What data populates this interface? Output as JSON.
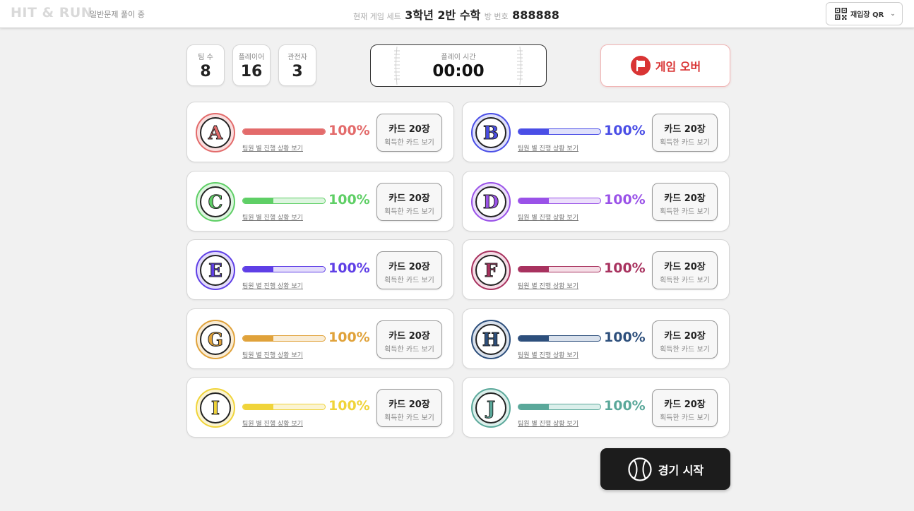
{
  "header": {
    "brand": "HIT & RUN",
    "mode": "일반문제 풀이 중",
    "set_label": "현재 게임 세트",
    "set_value": "3학년 2반 수학",
    "room_label": "방 번호",
    "room_value": "888888",
    "qr_label": "재입장 QR"
  },
  "stats": {
    "teams": {
      "label": "팀 수",
      "value": "8"
    },
    "players": {
      "label": "플레이어",
      "value": "16"
    },
    "spectators": {
      "label": "관전자",
      "value": "3"
    }
  },
  "timer": {
    "label": "플레이 시간",
    "value": "00:00"
  },
  "game_over_label": "게임 오버",
  "start_label": "경기 시작",
  "teams": [
    {
      "letter": "A",
      "color": "#e36b6b",
      "light": "#f9dede",
      "progress": 1.0,
      "fill": 1.0,
      "percent": "100%",
      "link": "팀원 별 진행 상황 보기",
      "card_title": "카드 20장",
      "card_sub": "획득한 카드 보기"
    },
    {
      "letter": "B",
      "color": "#4a4ee6",
      "light": "#dfe0fb",
      "progress": 1.0,
      "fill": 0.37,
      "percent": "100%",
      "link": "팀원 별 진행 상황 보기",
      "card_title": "카드 20장",
      "card_sub": "획득한 카드 보기"
    },
    {
      "letter": "C",
      "color": "#5fcf66",
      "light": "#ddf5df",
      "progress": 1.0,
      "fill": 0.37,
      "percent": "100%",
      "link": "팀원 별 진행 상황 보기",
      "card_title": "카드 20장",
      "card_sub": "획득한 카드 보기"
    },
    {
      "letter": "D",
      "color": "#9a52e8",
      "light": "#ecdffb",
      "progress": 1.0,
      "fill": 0.37,
      "percent": "100%",
      "link": "팀원 별 진행 상황 보기",
      "card_title": "카드 20장",
      "card_sub": "획득한 카드 보기"
    },
    {
      "letter": "E",
      "color": "#5f3fe6",
      "light": "#e3dcfb",
      "progress": 1.0,
      "fill": 0.37,
      "percent": "100%",
      "link": "팀원 별 진행 상황 보기",
      "card_title": "카드 20장",
      "card_sub": "획득한 카드 보기"
    },
    {
      "letter": "F",
      "color": "#a8325f",
      "light": "#f5dde6",
      "progress": 1.0,
      "fill": 0.37,
      "percent": "100%",
      "link": "팀원 별 진행 상황 보기",
      "card_title": "카드 20장",
      "card_sub": "획득한 카드 보기"
    },
    {
      "letter": "G",
      "color": "#e0a23a",
      "light": "#f9ecd5",
      "progress": 1.0,
      "fill": 0.37,
      "percent": "100%",
      "link": "팀원 별 진행 상황 보기",
      "card_title": "카드 20장",
      "card_sub": "획득한 카드 보기"
    },
    {
      "letter": "H",
      "color": "#2d4f7c",
      "light": "#d9e1ec",
      "progress": 1.0,
      "fill": 0.37,
      "percent": "100%",
      "link": "팀원 별 진행 상황 보기",
      "card_title": "카드 20장",
      "card_sub": "획득한 카드 보기"
    },
    {
      "letter": "I",
      "color": "#f0d43a",
      "light": "#fbf4d2",
      "progress": 1.0,
      "fill": 0.37,
      "percent": "100%",
      "link": "팀원 별 진행 상황 보기",
      "card_title": "카드 20장",
      "card_sub": "획득한 카드 보기"
    },
    {
      "letter": "J",
      "color": "#5aa89a",
      "light": "#dbefeb",
      "progress": 1.0,
      "fill": 0.37,
      "percent": "100%",
      "link": "팀원 별 진행 상황 보기",
      "card_title": "카드 20장",
      "card_sub": "획득한 카드 보기"
    }
  ]
}
